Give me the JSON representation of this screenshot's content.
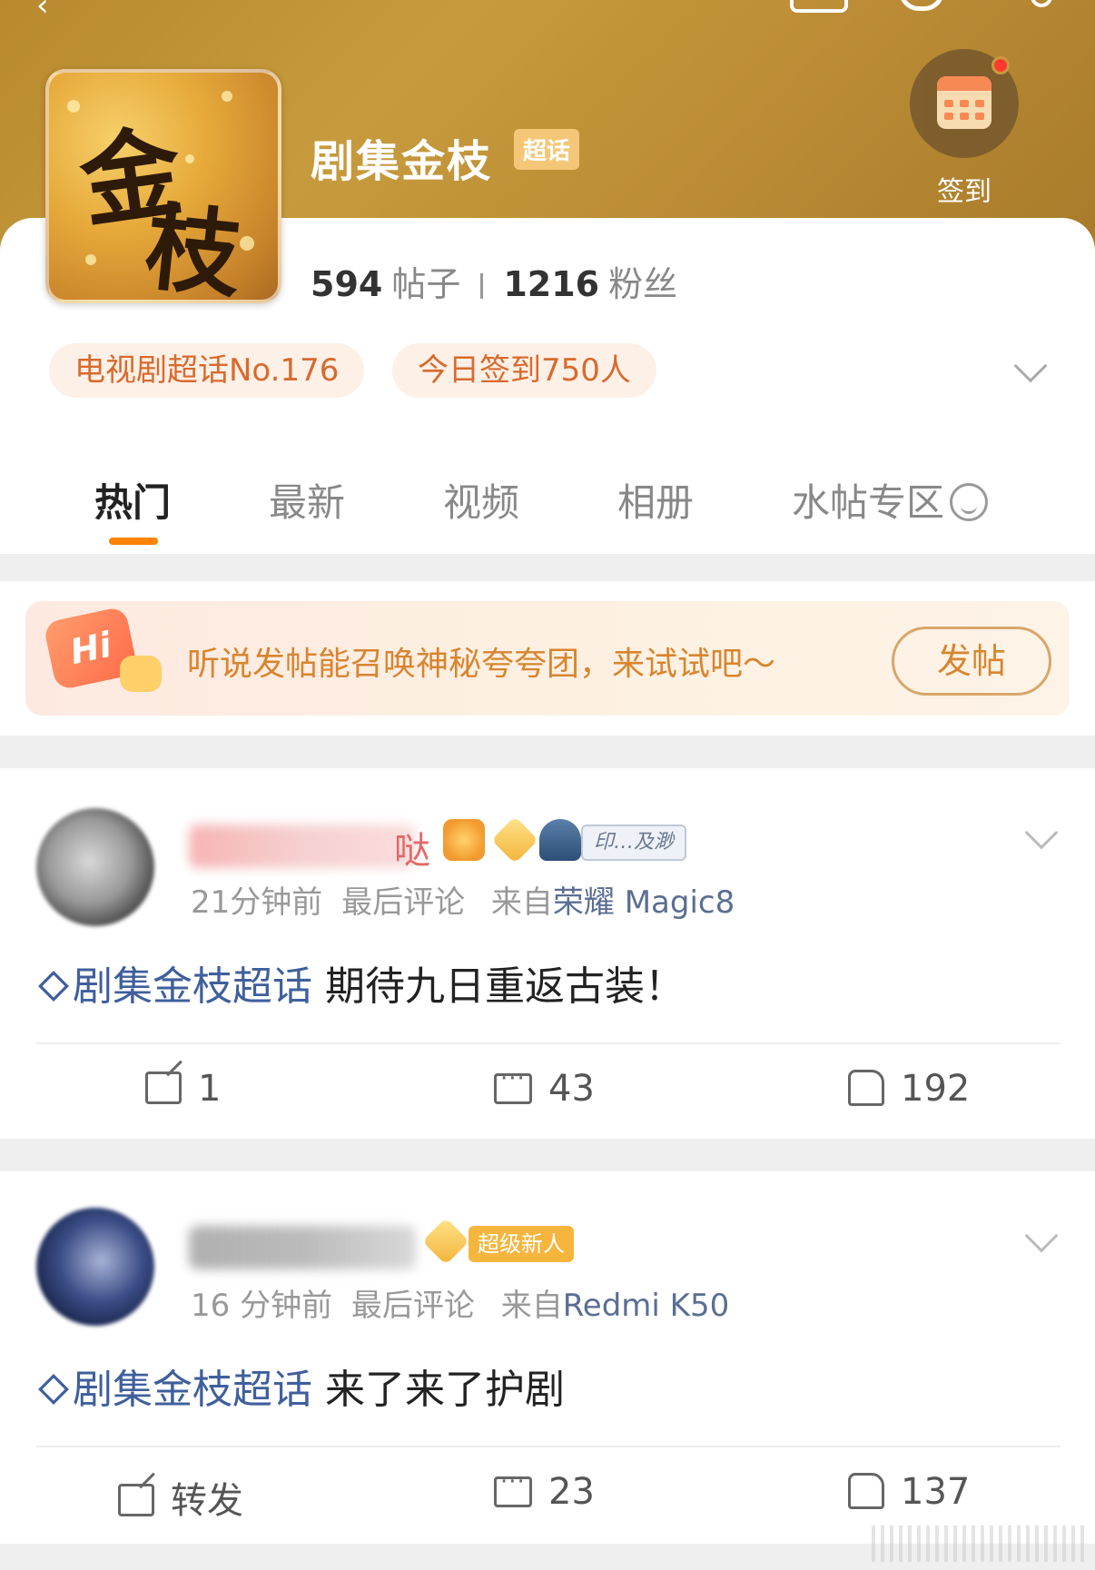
{
  "header": {
    "title": "剧集金枝",
    "badge": "超话",
    "logo_text_1": "金",
    "logo_text_2": "枝",
    "checkin_label": "签到"
  },
  "stats": {
    "posts_count": "594",
    "posts_unit": "帖子",
    "fans_count": "1216",
    "fans_unit": "粉丝"
  },
  "pills": {
    "rank": "电视剧超话No.176",
    "checkins": "今日签到750人"
  },
  "tabs": [
    "热门",
    "最新",
    "视频",
    "相册",
    "水帖专区"
  ],
  "promo": {
    "hi": "Hi",
    "text": "听说发帖能召唤神秘夸夸团，来试试吧～",
    "button": "发帖"
  },
  "posts": [
    {
      "username_tail": "哒",
      "tag": "印…及渺",
      "time": "21分钟前",
      "last_comment": "最后评论",
      "from_prefix": "来自",
      "device": "荣耀 Magic8",
      "topic": "剧集金枝超话",
      "text": "期待九日重返古装！",
      "reposts": "1",
      "comments": "43",
      "likes": "192"
    },
    {
      "badge": "超级新人",
      "time": "16 分钟前",
      "last_comment": "最后评论",
      "from_prefix": "来自",
      "device": "Redmi K50",
      "topic": "剧集金枝超话",
      "text": "来了来了护剧",
      "reposts": "转发",
      "comments": "23",
      "likes": "137"
    }
  ],
  "colors": {
    "banner": "#c79b3d",
    "accent": "#ff8200",
    "pill_text": "#d86a2e",
    "topic_link": "#3f5f9c"
  }
}
